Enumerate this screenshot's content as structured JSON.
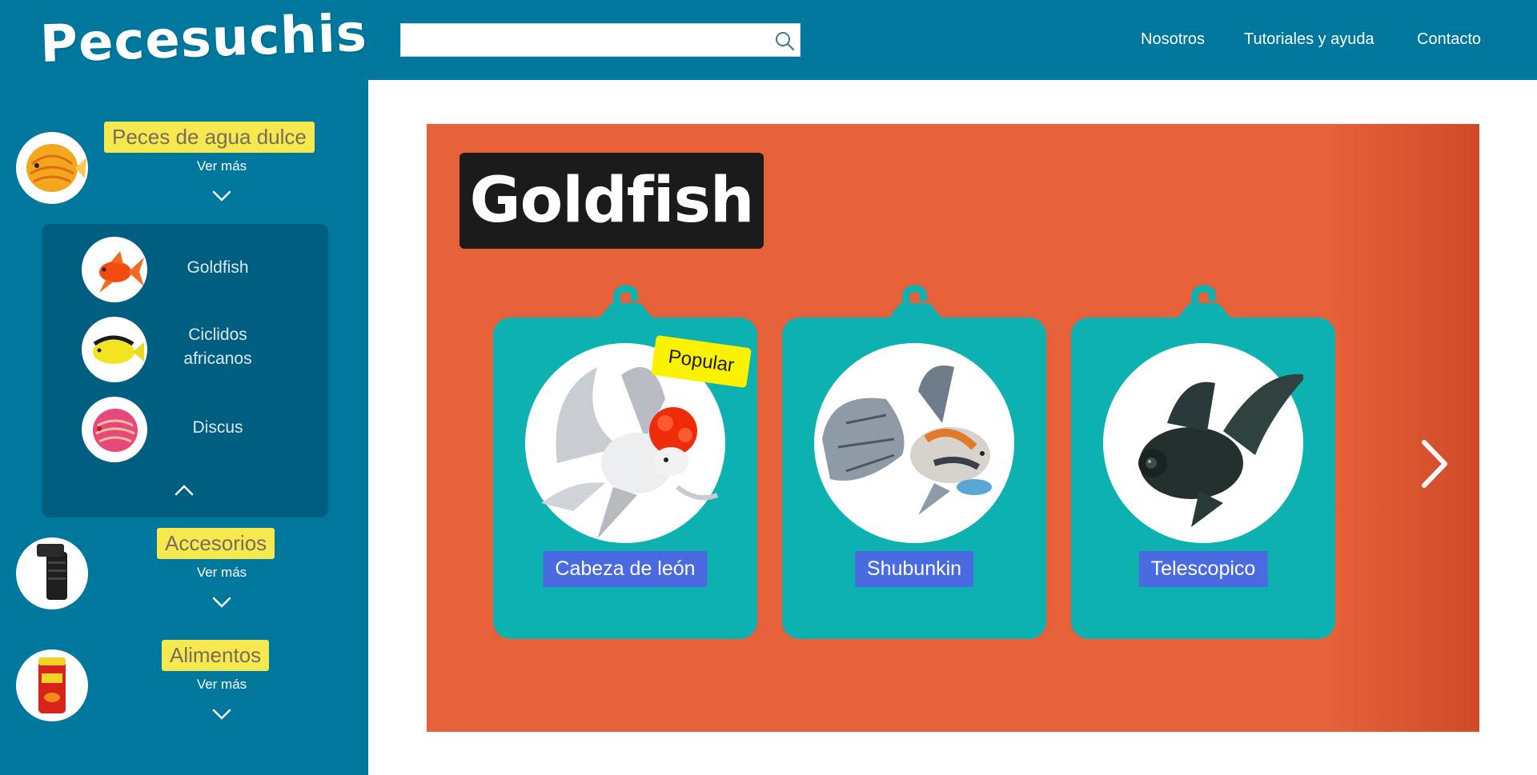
{
  "header": {
    "logo": "Pecesuchis",
    "search": {
      "value": "",
      "placeholder": ""
    },
    "nav": [
      "Nosotros",
      "Tutoriales y ayuda",
      "Contacto"
    ]
  },
  "sidebar": {
    "categories": [
      {
        "title": "Peces de agua dulce",
        "more": "Ver más",
        "expanded": true
      },
      {
        "title": "Accesorios",
        "more": "Ver más",
        "expanded": false
      },
      {
        "title": "Alimentos",
        "more": "Ver más",
        "expanded": false
      }
    ],
    "submenu": [
      "Goldfish",
      "Ciclidos africanos",
      "Discus"
    ]
  },
  "main": {
    "title": "Goldfish",
    "cards": [
      {
        "label": "Cabeza de león",
        "badge": "Popular"
      },
      {
        "label": "Shubunkin"
      },
      {
        "label": "Telescopico"
      }
    ]
  },
  "colors": {
    "header_bg": "#00779c",
    "submenu_bg": "#005f80",
    "category_tag": "#f6e84f",
    "banner": "#e6603a",
    "card": "#0db1b0",
    "card_label": "#4a6ae1",
    "badge": "#fbf200"
  }
}
